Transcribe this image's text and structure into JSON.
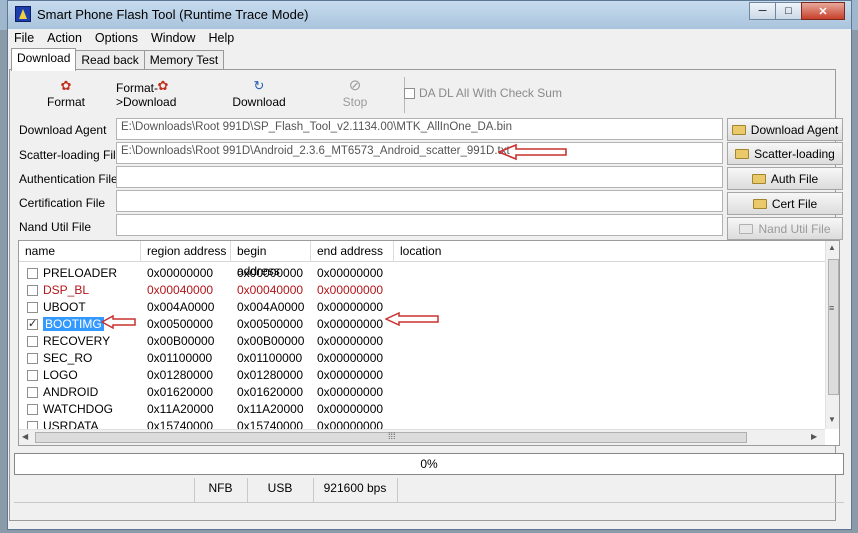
{
  "window": {
    "title": "Smart Phone Flash Tool (Runtime Trace Mode)",
    "controls": {
      "minimize": "─",
      "maximize": "□",
      "close": "✕"
    }
  },
  "menu": [
    "File",
    "Action",
    "Options",
    "Window",
    "Help"
  ],
  "tabs": [
    "Download",
    "Read back",
    "Memory Test"
  ],
  "toolbar": {
    "format": "Format",
    "format_download": "Format->Download",
    "download": "Download",
    "stop": "Stop",
    "checksum_label": "DA DL All With Check Sum"
  },
  "files": {
    "download_agent": {
      "label": "Download Agent",
      "value": "E:\\Downloads\\Root 991D\\SP_Flash_Tool_v2.1134.00\\MTK_AllInOne_DA.bin",
      "button": "Download Agent"
    },
    "scatter": {
      "label": "Scatter-loading File",
      "value": "E:\\Downloads\\Root 991D\\Android_2.3.6_MT6573_Android_scatter_991D.txt",
      "button": "Scatter-loading"
    },
    "auth": {
      "label": "Authentication File",
      "value": "",
      "button": "Auth File"
    },
    "cert": {
      "label": "Certification File",
      "value": "",
      "button": "Cert File"
    },
    "nand": {
      "label": "Nand Util File",
      "value": "",
      "button": "Nand Util File"
    }
  },
  "table": {
    "columns": [
      "name",
      "region address",
      "begin address",
      "end address",
      "location"
    ],
    "rows": [
      {
        "name": "PRELOADER",
        "region": "0x00000000",
        "begin": "0x00000000",
        "end": "0x00000000",
        "checked": false
      },
      {
        "name": "DSP_BL",
        "region": "0x00040000",
        "begin": "0x00040000",
        "end": "0x00000000",
        "checked": false
      },
      {
        "name": "UBOOT",
        "region": "0x004A0000",
        "begin": "0x004A0000",
        "end": "0x00000000",
        "checked": false
      },
      {
        "name": "BOOTIMG",
        "region": "0x00500000",
        "begin": "0x00500000",
        "end": "0x00000000",
        "checked": true
      },
      {
        "name": "RECOVERY",
        "region": "0x00B00000",
        "begin": "0x00B00000",
        "end": "0x00000000",
        "checked": false
      },
      {
        "name": "SEC_RO",
        "region": "0x01100000",
        "begin": "0x01100000",
        "end": "0x00000000",
        "checked": false
      },
      {
        "name": "LOGO",
        "region": "0x01280000",
        "begin": "0x01280000",
        "end": "0x00000000",
        "checked": false
      },
      {
        "name": "ANDROID",
        "region": "0x01620000",
        "begin": "0x01620000",
        "end": "0x00000000",
        "checked": false
      },
      {
        "name": "WATCHDOG",
        "region": "0x11A20000",
        "begin": "0x11A20000",
        "end": "0x00000000",
        "checked": false
      },
      {
        "name": "USRDATA",
        "region": "0x15740000",
        "begin": "0x15740000",
        "end": "0x00000000",
        "checked": false
      }
    ]
  },
  "progress": {
    "text": "0%",
    "value": 0
  },
  "status": {
    "nfb": "NFB",
    "usb": "USB",
    "baud": "921600 bps"
  },
  "colors": {
    "accent_red": "#b0161a",
    "selection": "#3399ff",
    "annotation_arrow": "#c8322f"
  }
}
